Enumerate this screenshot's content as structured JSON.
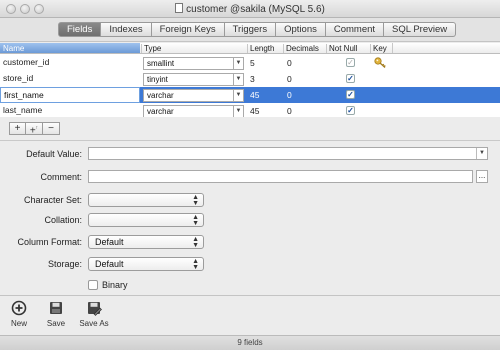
{
  "window": {
    "title": "customer @sakila (MySQL 5.6)"
  },
  "tabs": [
    {
      "label": "Fields",
      "active": true
    },
    {
      "label": "Indexes"
    },
    {
      "label": "Foreign Keys"
    },
    {
      "label": "Triggers"
    },
    {
      "label": "Options"
    },
    {
      "label": "Comment"
    },
    {
      "label": "SQL Preview"
    }
  ],
  "grid": {
    "columns": [
      "Name",
      "Type",
      "Length",
      "Decimals",
      "Not Null",
      "Key"
    ],
    "rows": [
      {
        "name": "customer_id",
        "type": "smallint",
        "length": "5",
        "decimals": "0",
        "not_null": true,
        "key": true,
        "selected": false
      },
      {
        "name": "store_id",
        "type": "tinyint",
        "length": "3",
        "decimals": "0",
        "not_null": true,
        "key": false,
        "selected": false
      },
      {
        "name": "first_name",
        "type": "varchar",
        "length": "45",
        "decimals": "0",
        "not_null": true,
        "key": false,
        "selected": true
      },
      {
        "name": "last_name",
        "type": "varchar",
        "length": "45",
        "decimals": "0",
        "not_null": true,
        "key": false,
        "selected": false
      }
    ]
  },
  "minibar": {
    "add": "+",
    "insert": "+",
    "remove": "−"
  },
  "form": {
    "default_value_label": "Default Value:",
    "default_value": "",
    "comment_label": "Comment:",
    "comment": "",
    "comment_more": "...",
    "charset_label": "Character Set:",
    "charset": "",
    "collation_label": "Collation:",
    "collation": "",
    "column_format_label": "Column Format:",
    "column_format": "Default",
    "storage_label": "Storage:",
    "storage": "Default",
    "binary_label": "Binary",
    "binary_checked": false
  },
  "bottom": {
    "new_label": "New",
    "save_label": "Save",
    "saveas_label": "Save As"
  },
  "status": {
    "text": "9 fields"
  },
  "colors": {
    "selection": "#3d79d6",
    "active_tab": "#7b7b7b",
    "key": "#e0b33c"
  },
  "icons": {
    "key": "key-icon",
    "new": "plus-circle-icon",
    "save": "floppy-disk-icon",
    "save_as": "floppy-disk-pencil-icon"
  }
}
